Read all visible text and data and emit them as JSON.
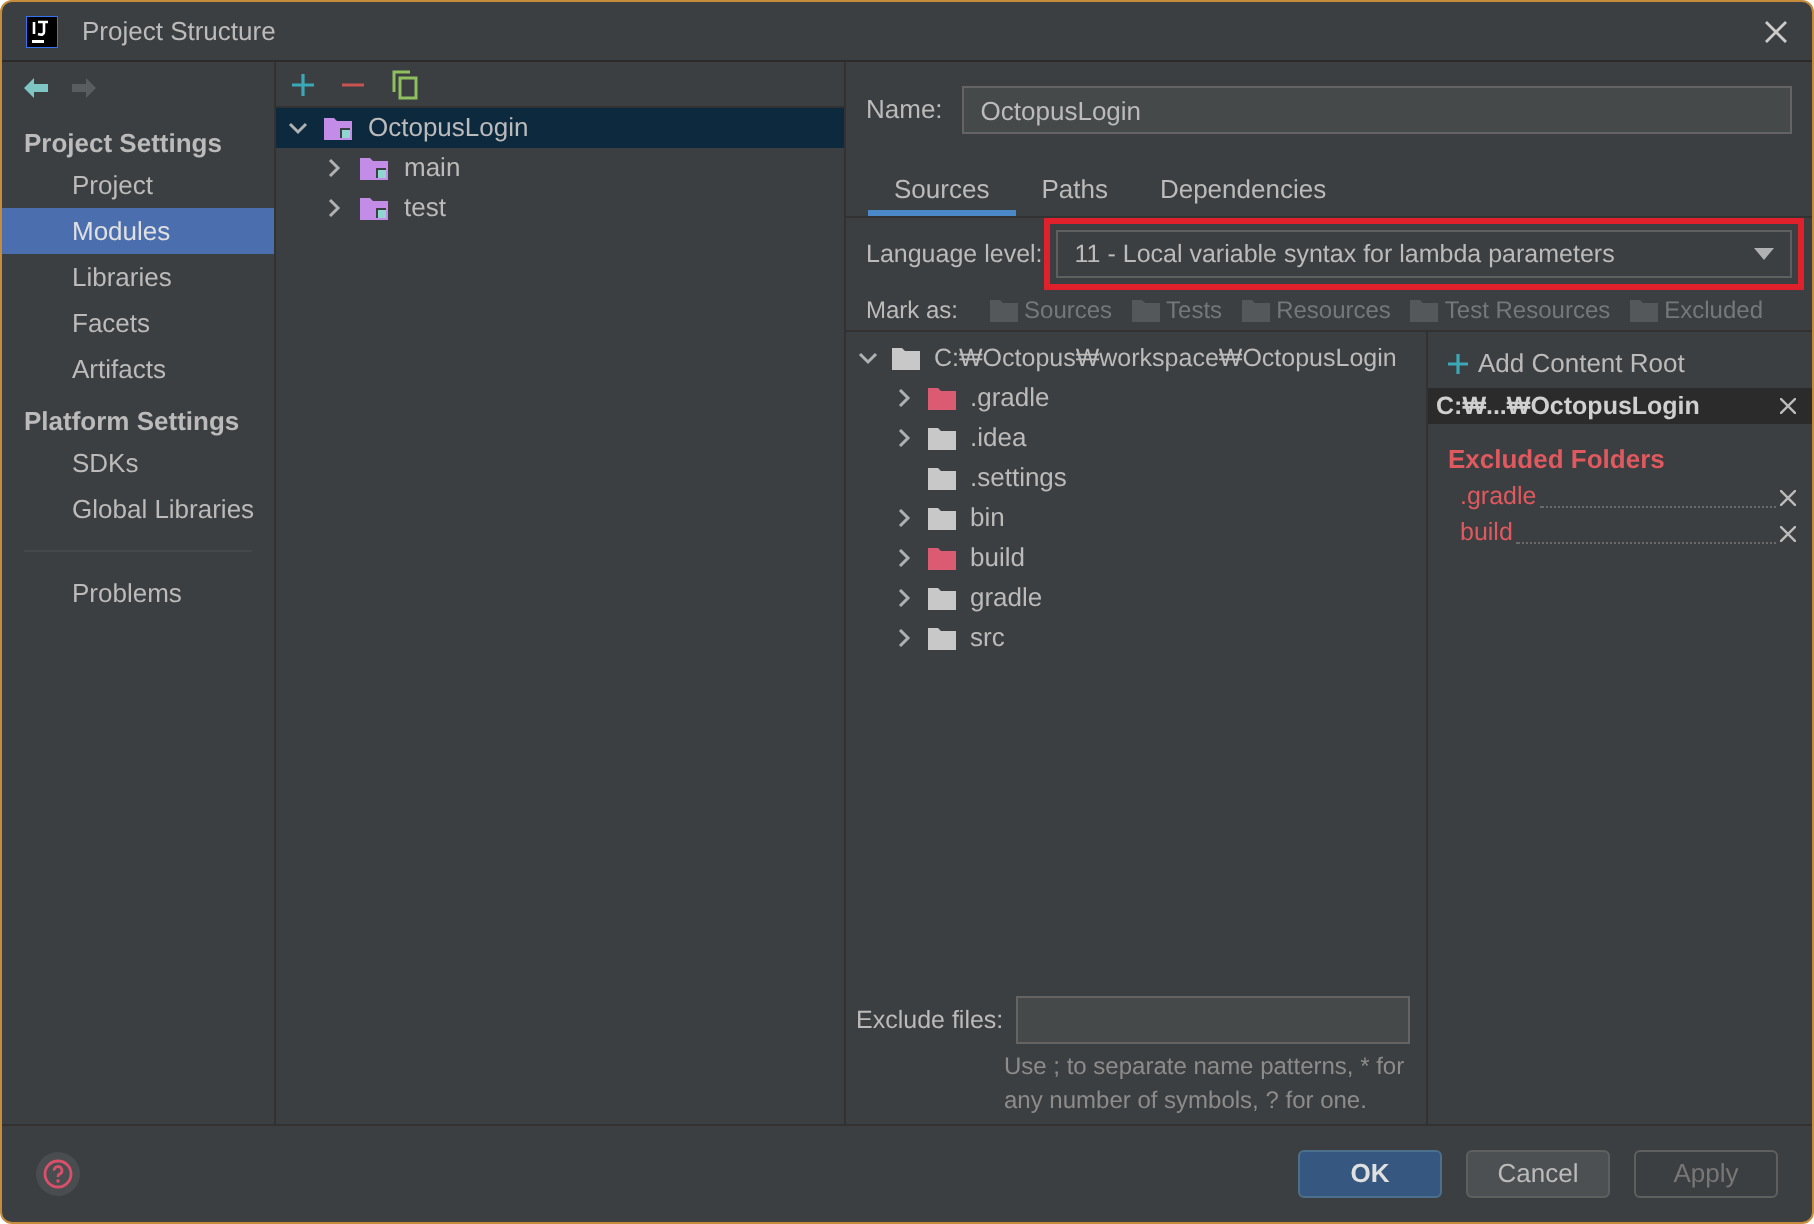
{
  "window": {
    "title": "Project Structure"
  },
  "sidebar": {
    "sections": [
      {
        "title": "Project Settings",
        "items": [
          {
            "label": "Project",
            "selected": false
          },
          {
            "label": "Modules",
            "selected": true
          },
          {
            "label": "Libraries",
            "selected": false
          },
          {
            "label": "Facets",
            "selected": false
          },
          {
            "label": "Artifacts",
            "selected": false
          }
        ]
      },
      {
        "title": "Platform Settings",
        "items": [
          {
            "label": "SDKs",
            "selected": false
          },
          {
            "label": "Global Libraries",
            "selected": false
          }
        ]
      }
    ],
    "footer_items": [
      {
        "label": "Problems",
        "selected": false
      }
    ]
  },
  "module_tree": [
    {
      "label": "OctopusLogin",
      "selected": true,
      "expanded": true,
      "children": [
        {
          "label": "main",
          "selected": false,
          "expanded": false
        },
        {
          "label": "test",
          "selected": false,
          "expanded": false
        }
      ]
    }
  ],
  "name_field": {
    "label": "Name:",
    "value": "OctopusLogin"
  },
  "tabs": [
    {
      "label": "Sources",
      "selected": true
    },
    {
      "label": "Paths",
      "selected": false
    },
    {
      "label": "Dependencies",
      "selected": false
    }
  ],
  "language_level": {
    "label": "Language level:",
    "value": "11 - Local variable syntax for lambda parameters",
    "highlighted": true
  },
  "mark_as": {
    "label": "Mark as:",
    "buttons": [
      {
        "label": "Sources",
        "disabled": true
      },
      {
        "label": "Tests",
        "disabled": true
      },
      {
        "label": "Resources",
        "disabled": true
      },
      {
        "label": "Test Resources",
        "disabled": true
      },
      {
        "label": "Excluded",
        "disabled": true
      }
    ]
  },
  "content_tree": [
    {
      "label": "C:₩Octopus₩workspace₩OctopusLogin",
      "kind": "folder",
      "expanded": true,
      "children": [
        {
          "label": ".gradle",
          "kind": "excluded",
          "has_children": true
        },
        {
          "label": ".idea",
          "kind": "folder",
          "has_children": true
        },
        {
          "label": ".settings",
          "kind": "folder",
          "has_children": false
        },
        {
          "label": "bin",
          "kind": "folder",
          "has_children": true
        },
        {
          "label": "build",
          "kind": "excluded",
          "has_children": true
        },
        {
          "label": "gradle",
          "kind": "folder",
          "has_children": true
        },
        {
          "label": "src",
          "kind": "folder",
          "has_children": true
        }
      ]
    }
  ],
  "content_root": {
    "add_label": "Add Content Root",
    "root": "C:₩...₩OctopusLogin",
    "excluded_title": "Excluded Folders",
    "excluded": [
      ".gradle",
      "build"
    ]
  },
  "exclude_files": {
    "label": "Exclude files:",
    "hint": "Use ; to separate name patterns, * for any number of symbols, ? for one."
  },
  "buttons": [
    {
      "label": "OK",
      "kind": "primary",
      "disabled": false
    },
    {
      "label": "Cancel",
      "kind": "normal",
      "disabled": false
    },
    {
      "label": "Apply",
      "kind": "normal",
      "disabled": true
    }
  ]
}
